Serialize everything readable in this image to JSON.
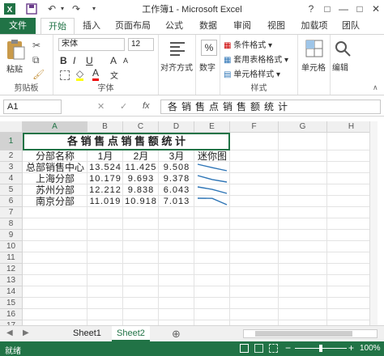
{
  "window": {
    "title": "工作簿1 - Microsoft Excel",
    "controls": [
      "?",
      "□",
      "—",
      "□",
      "✕"
    ]
  },
  "tabs": [
    {
      "label": "文件"
    },
    {
      "label": "开始"
    },
    {
      "label": "插入"
    },
    {
      "label": "页面布局"
    },
    {
      "label": "公式"
    },
    {
      "label": "数据"
    },
    {
      "label": "审阅"
    },
    {
      "label": "视图"
    },
    {
      "label": "加载项"
    },
    {
      "label": "团队"
    }
  ],
  "ribbon": {
    "clipboard": {
      "paste": "粘贴",
      "group": "剪贴板"
    },
    "font": {
      "name": "宋体",
      "size": "12",
      "group": "字体",
      "bold": "B",
      "italic": "I",
      "underline": "U",
      "grow": "A",
      "shrink": "A",
      "fontcolor": "A",
      "phonetic": "文"
    },
    "alignment": {
      "label": "对齐方式"
    },
    "number": {
      "label": "数字",
      "symbol": "%"
    },
    "styles": {
      "cond": "条件格式",
      "table": "套用表格格式",
      "cell": "单元格样式",
      "group": "样式"
    },
    "cells": {
      "label": "单元格"
    },
    "editing": {
      "label": "编辑"
    }
  },
  "formula_bar": {
    "name_box": "A1",
    "fx": "fx",
    "cancel": "✕",
    "enter": "✓",
    "value": "各销售点销售额统计"
  },
  "columns": [
    "A",
    "B",
    "C",
    "D",
    "E",
    "F",
    "G",
    "H"
  ],
  "rows": [
    "1",
    "2",
    "3",
    "4",
    "5",
    "6",
    "7",
    "8",
    "9",
    "10",
    "11",
    "12",
    "13",
    "14",
    "15",
    "16",
    "17"
  ],
  "sheet": {
    "title": "各 销 售 点 销 售 额 统 计",
    "header": [
      "分部名称",
      "1月",
      "2月",
      "3月",
      "迷你图"
    ],
    "data": [
      [
        "总部销售中心",
        "13.524",
        "11.425",
        "9.508"
      ],
      [
        "上海分部",
        "10.179",
        "9.693",
        "9.378"
      ],
      [
        "苏州分部",
        "12.212",
        "9.838",
        "6.043"
      ],
      [
        "南京分部",
        "11.019",
        "10.918",
        "7.013"
      ]
    ],
    "sparklines": [
      [
        13.524,
        11.425,
        9.508
      ],
      [
        10.179,
        9.693,
        9.378
      ],
      [
        12.212,
        9.838,
        6.043
      ],
      [
        11.019,
        10.918,
        7.013
      ]
    ]
  },
  "sheets": [
    {
      "label": "Sheet1"
    },
    {
      "label": "Sheet2"
    }
  ],
  "add_sheet": "⊕",
  "status": {
    "ready": "就绪",
    "zoom": "100%"
  },
  "colors": {
    "accent": "#217346",
    "title_border": "#217346",
    "sparkline": "#2e75b6"
  }
}
